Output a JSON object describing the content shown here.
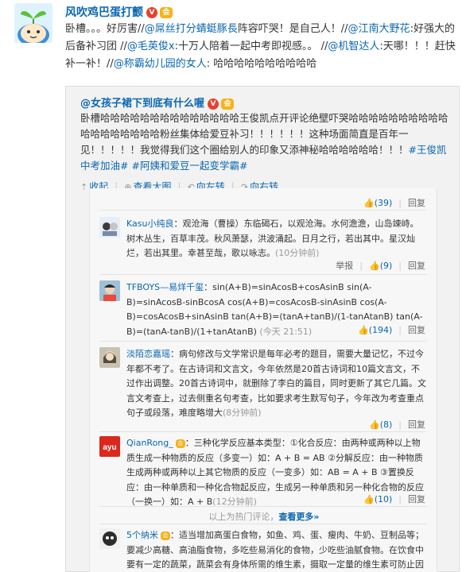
{
  "post": {
    "username": "风吹鸡巴蛋打颤",
    "segments": [
      {
        "t": "卧槽。。。好厉害//",
        "link": false
      },
      {
        "t": "@屌丝打分蜻蜓豚長",
        "link": true
      },
      {
        "t": "阵容吓哭！是自己人！//",
        "link": false
      },
      {
        "t": "@江南大野花",
        "link": true
      },
      {
        "t": ":好强大的后备补习团 //",
        "link": false
      },
      {
        "t": "@毛英俊x",
        "link": true
      },
      {
        "t": ":十万人陪着一起中考即视感。。 //",
        "link": false
      },
      {
        "t": "@机智达人",
        "link": true
      },
      {
        "t": ":天哪！！！赶快补一补！//",
        "link": false
      },
      {
        "t": "@称霸幼儿园的女人",
        "link": true
      },
      {
        "t": ": 哈哈哈哈哈哈哈哈哈哈",
        "link": false
      }
    ]
  },
  "repost": {
    "username": "@女孩子裙下到底有什么喔",
    "segments": [
      {
        "t": "卧槽哈哈哈哈哈哈哈哈哈哈哈哈哈哈王俊凯点开评论绝壁吓哭哈哈哈哈哈哈哈哈哈哈哈哈哈哈哈哈哈哈粉丝集体给爱豆补习！！！！！！这种场面简直是百年一见！！！！！我觉得我们这个圈给别人的印象又添神秘哈哈哈哈哈哈！！！",
        "link": false
      },
      {
        "t": "#王俊凯中考加油#",
        "link": true
      },
      {
        "t": " ",
        "link": false
      },
      {
        "t": "#阿姨和爱豆一起变学霸#",
        "link": true
      }
    ],
    "actions": {
      "collapse": "收起",
      "view_large": "查看大图",
      "rotate_left": "向左转",
      "rotate_right": "向右转"
    }
  },
  "comments_screenshot": {
    "top_like": "(39)",
    "reply_label": "回复",
    "report_label": "举报",
    "comments": [
      {
        "name": "Kasu小纯良",
        "text": "：观沧海（曹操）东临碣石，以观沧海。水何澹澹，山岛竦峙。树木丛生，百草丰茂。秋风萧瑟，洪波涌起。日月之行，若出其中。星汉灿烂，若出其里。幸甚至哉，歌以咏志。",
        "time": "(10分钟前)",
        "likes": "(9)",
        "avatar": "kasu"
      },
      {
        "name": "TFBOYS—易烊千玺",
        "text": "：sin(A+B)=sinAcosB+cosAsinB sin(A-B)=sinAcosB-sinBcosA cos(A+B)=cosAcosB-sinAsinB cos(A-B)=cosAcosB+sinAsinB tan(A+B)=(tanA+tanB)/(1-tanAtanB) tan(A-B)=(tanA-tanB)/(1+tanAtanB)",
        "time": "(今天 21:51)",
        "likes": "(194)",
        "avatar": "tfboys"
      },
      {
        "name": "淡陌恋嘉瑶",
        "text": "：病句修改与文学常识是每年必考的题目，需要大量记忆，不过今年都不考了。在古诗词和文言文，今年依然是20首古诗词和10篇文言文，不过作出调整。20首古诗词中，就删除了李白的篇目，同时更新了其它几篇。文言文考查上，过去侧重名句考查，比如要求考生默写句子，今年改为考查重点句子或段落，难度略增大",
        "time": "(8分钟前)",
        "likes": "(8)",
        "avatar": "danmo"
      },
      {
        "name": "QianRong_",
        "text": "：三种化学反应基本类型：①化合反应：由两种或两种以上物质生成一种物质的反应（多变一）如：A + B = AB ②分解反应：由一种物质生成两种或两种以上其它物质的反应（一变多）如：AB = A + B ③置换反应：由一种单质和一种化合物起反应，生成另一种单质和另一种化合物的反应（一换一）如：A + B",
        "time": "(12分钟前)",
        "likes": "(10)",
        "avatar": "qian"
      },
      {
        "name": "5个纳米",
        "text": "：适当增加高蛋白食物，如鱼、鸡、蛋、瘦肉、牛奶、豆制品等；要减少高糖、高油脂食物，多吃些易消化的食物，少吃些油腻食物。在饮食中要有一定的蔬菜，蔬菜会有身体所需的维生素，摄取一定量的维生素可防止因用脑过度而导致记忆力下降。",
        "time": "",
        "likes": "",
        "avatar": "nami"
      }
    ],
    "hot_note_prefix": "以上为热门评论，",
    "hot_note_link": "查看更多»"
  },
  "colors": {
    "link": "#0a67b0",
    "text": "#333333",
    "repost_bg": "#f2f2f2",
    "panel_bg": "#f7f7f7"
  }
}
